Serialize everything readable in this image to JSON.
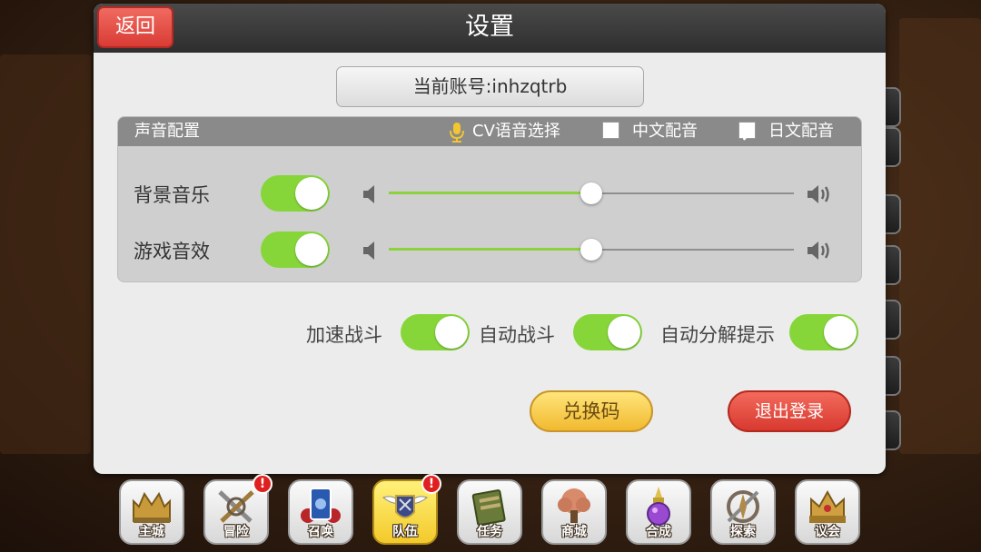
{
  "header": {
    "title": "设置",
    "back_label": "返回"
  },
  "account": {
    "text": "当前账号:inhzqtrb"
  },
  "sound": {
    "section_label": "声音配置",
    "cv_label": "CV语音选择",
    "voice_options": [
      {
        "label": "中文配音",
        "checked": false
      },
      {
        "label": "日文配音",
        "checked": true
      }
    ],
    "rows": [
      {
        "label": "背景音乐",
        "enabled": true,
        "volume": 0.5
      },
      {
        "label": "游戏音效",
        "enabled": true,
        "volume": 0.5
      }
    ]
  },
  "options": [
    {
      "label": "加速战斗",
      "enabled": true
    },
    {
      "label": "自动战斗",
      "enabled": true
    },
    {
      "label": "自动分解提示",
      "enabled": true
    }
  ],
  "buttons": {
    "redeem": "兑换码",
    "logout": "退出登录"
  },
  "nav": [
    {
      "label": "主城",
      "icon": "castle-icon",
      "badge": false,
      "active": false
    },
    {
      "label": "冒险",
      "icon": "crossed-swords-icon",
      "badge": true,
      "active": false
    },
    {
      "label": "召唤",
      "icon": "summon-card-icon",
      "badge": false,
      "active": false
    },
    {
      "label": "队伍",
      "icon": "winged-shield-icon",
      "badge": true,
      "active": true
    },
    {
      "label": "任务",
      "icon": "quest-scroll-icon",
      "badge": false,
      "active": false
    },
    {
      "label": "商城",
      "icon": "shop-tree-icon",
      "badge": false,
      "active": false
    },
    {
      "label": "合成",
      "icon": "synthesis-potion-icon",
      "badge": false,
      "active": false
    },
    {
      "label": "探索",
      "icon": "compass-icon",
      "badge": false,
      "active": false
    },
    {
      "label": "议会",
      "icon": "council-crown-icon",
      "badge": false,
      "active": false
    }
  ],
  "colors": {
    "toggle_on": "#86d63a",
    "back_button": "#e04a42",
    "redeem_button": "#f5c842",
    "logout_button": "#e04a3c",
    "active_nav": "#f3c92a"
  }
}
